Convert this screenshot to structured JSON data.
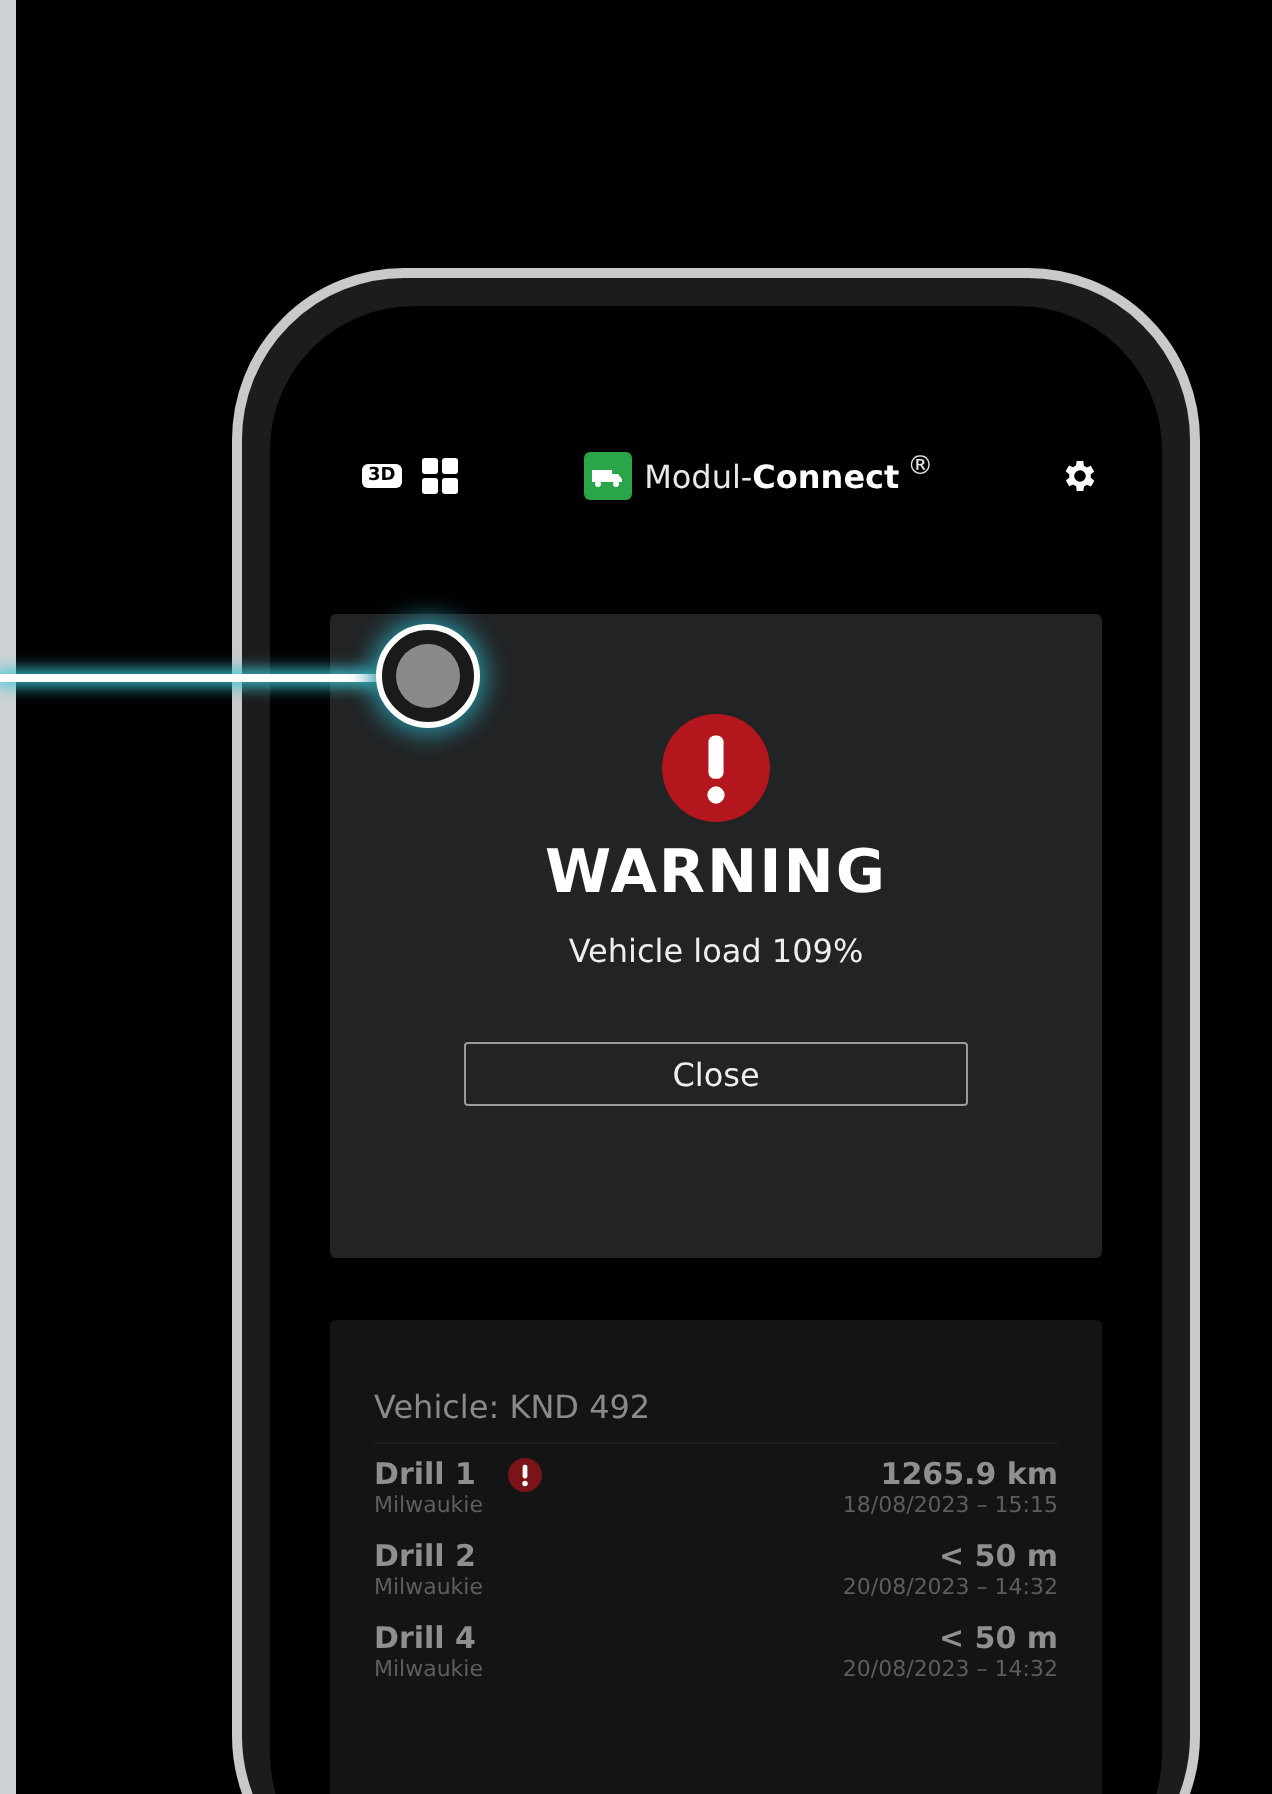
{
  "header": {
    "badge": "3D",
    "brand_light": "Modul-",
    "brand_bold": "Connect",
    "brand_mark": "®"
  },
  "warning": {
    "title": "WARNING",
    "message": "Vehicle load 109%",
    "button": "Close"
  },
  "vehicle": {
    "label": "Vehicle: KND 492",
    "tools": [
      {
        "name": "Drill 1",
        "location": "Milwaukie",
        "distance": "1265.9 km",
        "time": "18/08/2023 – 15:15",
        "alert": true
      },
      {
        "name": "Drill 2",
        "location": "Milwaukie",
        "distance": "< 50 m",
        "time": "20/08/2023 – 14:32",
        "alert": false
      },
      {
        "name": "Drill 4",
        "location": "Milwaukie",
        "distance": "< 50 m",
        "time": "20/08/2023 – 14:32",
        "alert": false
      }
    ]
  }
}
